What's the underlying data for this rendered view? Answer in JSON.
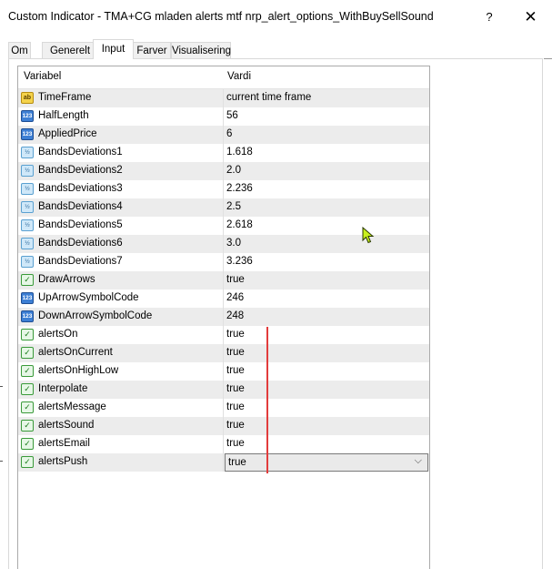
{
  "window": {
    "title": "Custom Indicator - TMA+CG mladen alerts mtf nrp_alert_options_WithBuySellSound",
    "help_label": "?",
    "close_label": "✕"
  },
  "tabs": [
    {
      "label": "Om"
    },
    {
      "label": "Generelt"
    },
    {
      "label": "Input"
    },
    {
      "label": "Farver"
    },
    {
      "label": "Visualisering"
    }
  ],
  "active_tab": "Input",
  "table": {
    "headers": {
      "variable": "Variabel",
      "value": "Vardi"
    },
    "rows": [
      {
        "icon": "string-type-icon",
        "name": "TimeFrame",
        "value": "current time frame"
      },
      {
        "icon": "integer-type-icon",
        "name": "HalfLength",
        "value": "56"
      },
      {
        "icon": "integer-type-icon",
        "name": "AppliedPrice",
        "value": "6"
      },
      {
        "icon": "double-type-icon",
        "name": "BandsDeviations1",
        "value": "1.618"
      },
      {
        "icon": "double-type-icon",
        "name": "BandsDeviations2",
        "value": "2.0"
      },
      {
        "icon": "double-type-icon",
        "name": "BandsDeviations3",
        "value": "2.236"
      },
      {
        "icon": "double-type-icon",
        "name": "BandsDeviations4",
        "value": "2.5"
      },
      {
        "icon": "double-type-icon",
        "name": "BandsDeviations5",
        "value": "2.618"
      },
      {
        "icon": "double-type-icon",
        "name": "BandsDeviations6",
        "value": "3.0"
      },
      {
        "icon": "double-type-icon",
        "name": "BandsDeviations7",
        "value": "3.236"
      },
      {
        "icon": "bool-type-icon",
        "name": "DrawArrows",
        "value": "true"
      },
      {
        "icon": "integer-type-icon",
        "name": "UpArrowSymbolCode",
        "value": "246"
      },
      {
        "icon": "integer-type-icon",
        "name": "DownArrowSymbolCode",
        "value": "248"
      },
      {
        "icon": "bool-type-icon",
        "name": "alertsOn",
        "value": "true"
      },
      {
        "icon": "bool-type-icon",
        "name": "alertsOnCurrent",
        "value": "true"
      },
      {
        "icon": "bool-type-icon",
        "name": "alertsOnHighLow",
        "value": "true"
      },
      {
        "icon": "bool-type-icon",
        "name": "Interpolate",
        "value": "true"
      },
      {
        "icon": "bool-type-icon",
        "name": "alertsMessage",
        "value": "true"
      },
      {
        "icon": "bool-type-icon",
        "name": "alertsSound",
        "value": "true"
      },
      {
        "icon": "bool-type-icon",
        "name": "alertsEmail",
        "value": "true"
      },
      {
        "icon": "bool-type-icon",
        "name": "alertsPush",
        "value": "true"
      }
    ],
    "selected_row": "alertsPush"
  },
  "icon_glyphs": {
    "string-type-icon": "ab",
    "integer-type-icon": "123",
    "double-type-icon": "½",
    "bool-type-icon": "✓"
  },
  "colors": {
    "annotation_line": "#e23c3c",
    "cursor": "#c8f01e"
  }
}
